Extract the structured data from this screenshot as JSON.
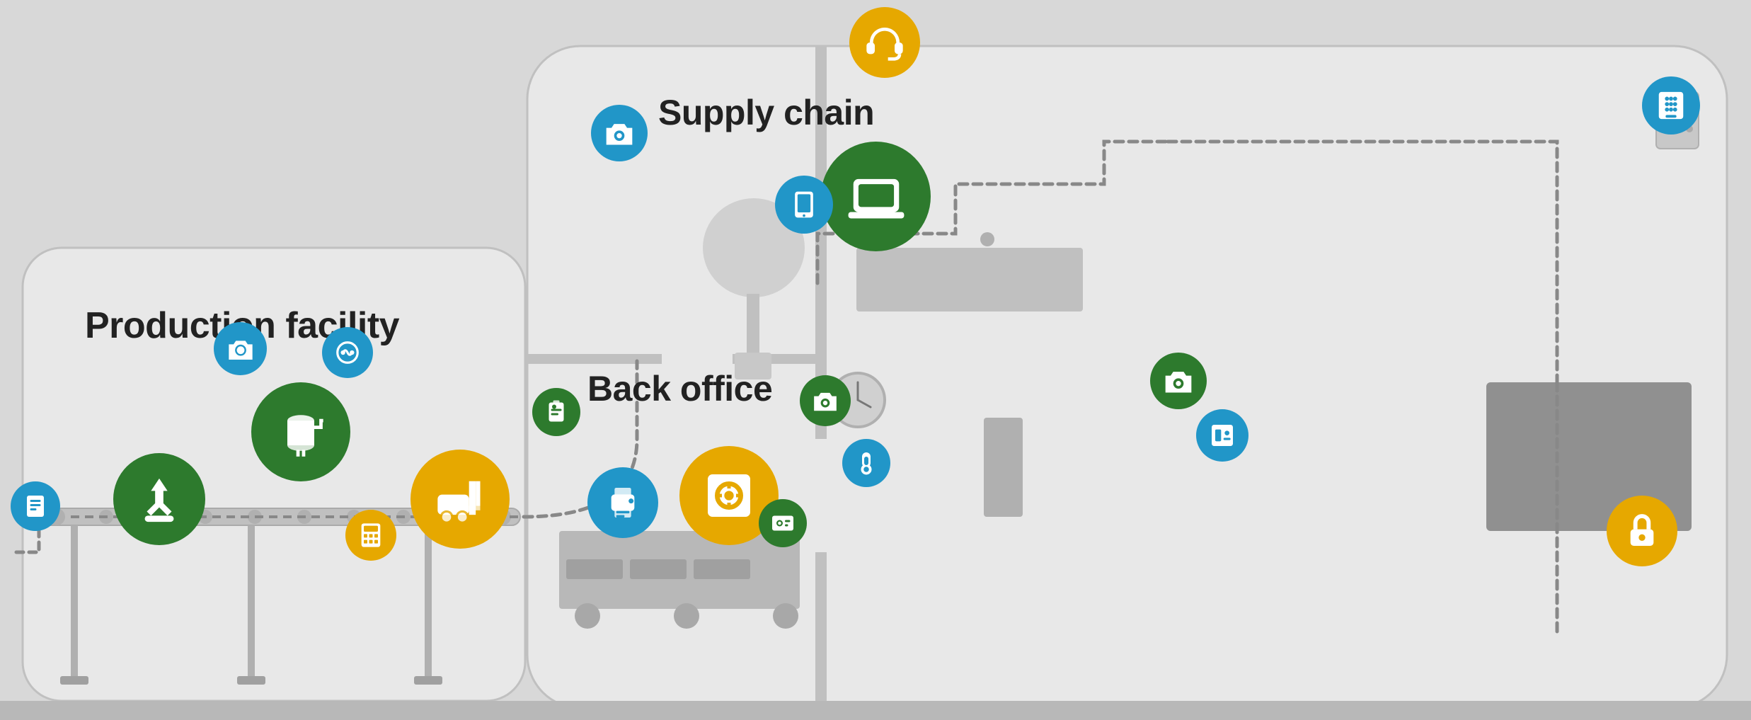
{
  "colors": {
    "blue": "#2196C8",
    "green": "#2D7A2D",
    "yellow": "#E6A800",
    "background": "#d8d8d8",
    "building": "#e8e8e8",
    "wall": "#c0c0c0"
  },
  "labels": {
    "production": "Production facility",
    "backoffice": "Back office",
    "supplychain": "Supply chain"
  },
  "icons": {
    "camera": "📷",
    "laptop": "💻",
    "phone": "📱",
    "printer": "🖨",
    "safe": "🔒",
    "server": "🖥",
    "robot": "🤖",
    "forklift": "🚛",
    "tank": "🏭",
    "keypad": "⌨",
    "badge": "🏷",
    "lock": "🔐",
    "relay": "⚙",
    "switch": "🔌",
    "thermostat": "🌡",
    "headset": "🎧"
  }
}
